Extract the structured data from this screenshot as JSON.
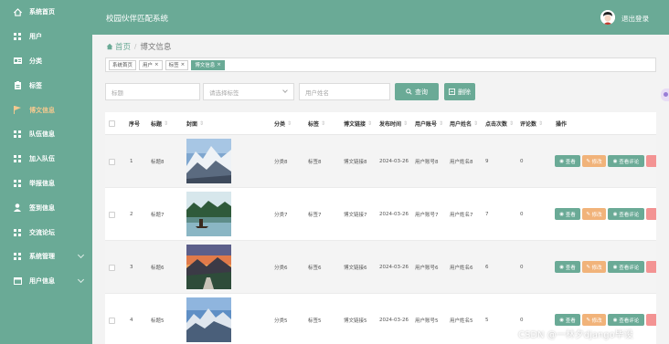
{
  "sidebar": {
    "items": [
      {
        "label": "系统首页",
        "icon": "home-icon"
      },
      {
        "label": "用户",
        "icon": "grid-icon"
      },
      {
        "label": "分类",
        "icon": "id-card-icon"
      },
      {
        "label": "标签",
        "icon": "clipboard-icon"
      },
      {
        "label": "博文信息",
        "icon": "flag-icon",
        "active": true
      },
      {
        "label": "队伍信息",
        "icon": "grid-icon"
      },
      {
        "label": "加入队伍",
        "icon": "grid-icon"
      },
      {
        "label": "举报信息",
        "icon": "grid-icon"
      },
      {
        "label": "签到信息",
        "icon": "user-icon"
      },
      {
        "label": "交流论坛",
        "icon": "grid-icon"
      },
      {
        "label": "系统管理",
        "icon": "grid-icon",
        "expandable": true
      },
      {
        "label": "用户信息",
        "icon": "calendar-icon",
        "expandable": true
      }
    ]
  },
  "header": {
    "title": "校园伙伴匹配系统",
    "logout": "退出登录"
  },
  "breadcrumb": {
    "home": "首页",
    "separator": "/",
    "current": "博文信息"
  },
  "tags": [
    {
      "label": "系统首页",
      "closable": false
    },
    {
      "label": "用户",
      "closable": true
    },
    {
      "label": "标签",
      "closable": true
    },
    {
      "label": "博文信息",
      "closable": true,
      "active": true
    }
  ],
  "filters": {
    "title_placeholder": "标题",
    "tag_placeholder": "请选择标签",
    "username_placeholder": "用户姓名",
    "search_label": "查询",
    "delete_label": "删除"
  },
  "table": {
    "headers": {
      "index": "序号",
      "title": "标题",
      "cover": "封面",
      "category": "分类",
      "tag": "标签",
      "link": "博文链接",
      "time": "发布时间",
      "account": "用户账号",
      "name": "用户姓名",
      "clicks": "点击次数",
      "comments": "评论数",
      "actions": "操作"
    },
    "rows": [
      {
        "index": "1",
        "title": "标题8",
        "category": "分类8",
        "tag": "标签8",
        "link": "博文链接8",
        "time": "2024-03-26",
        "account": "用户账号8",
        "name": "用户姓名8",
        "clicks": "9",
        "comments": "0",
        "cover": "snowy-mountains"
      },
      {
        "index": "2",
        "title": "标题7",
        "category": "分类7",
        "tag": "标签7",
        "link": "博文链接7",
        "time": "2024-03-26",
        "account": "用户账号7",
        "name": "用户姓名7",
        "clicks": "7",
        "comments": "0",
        "cover": "lake-boat"
      },
      {
        "index": "3",
        "title": "标题6",
        "category": "分类6",
        "tag": "标签6",
        "link": "博文链接6",
        "time": "2024-03-26",
        "account": "用户账号6",
        "name": "用户姓名6",
        "clicks": "6",
        "comments": "0",
        "cover": "sunset-valley"
      },
      {
        "index": "4",
        "title": "标题5",
        "category": "分类5",
        "tag": "标签5",
        "link": "博文链接5",
        "time": "2024-03-26",
        "account": "用户账号5",
        "name": "用户姓名5",
        "clicks": "5",
        "comments": "0",
        "cover": "mountain-range"
      }
    ],
    "actions": {
      "view": "查看",
      "edit": "修改",
      "comment": "查看评论"
    }
  },
  "watermark": "CSDN @一林夕django毕设",
  "colors": {
    "primary": "#6aaa96",
    "active_menu": "#f4c98f",
    "edit": "#f1b37a",
    "delete": "#f39393"
  }
}
